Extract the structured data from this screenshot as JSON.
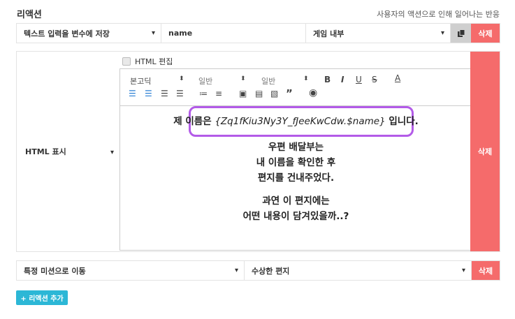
{
  "header": {
    "title": "리액션",
    "subtitle": "사용자의 액션으로 인해 일어나는 반응"
  },
  "row1": {
    "action": "텍스트 입력을 변수에 저장",
    "variable": "name",
    "scope": "게임 내부",
    "delete_label": "삭제"
  },
  "row2": {
    "action": "HTML 표시",
    "html_edit_label": "HTML 편집",
    "toolbar": {
      "font": "본고딕",
      "size": "일반",
      "style": "일반",
      "bold": "B",
      "italic": "I",
      "underline": "U",
      "strike": "S",
      "color": "A"
    },
    "content": {
      "line1_pre": "제 이름은 ",
      "line1_var": "{Zq1fKiu3Ny3Y_fJeeKwCdw.$name}",
      "line1_post": " 입니다.",
      "para1": [
        "우편 배달부는",
        "내 이름을 확인한 후",
        "편지를 건내주었다."
      ],
      "para2": [
        "과연 이 편지에는",
        "어떤 내용이 담겨있을까..?"
      ]
    },
    "delete_label": "삭제"
  },
  "row3": {
    "action": "특정 미션으로 이동",
    "mission": "수상한 편지",
    "delete_label": "삭제"
  },
  "add_button": "+ 리액션 추가",
  "colors": {
    "delete": "#f56b6b",
    "accent": "#2cb7d6",
    "highlight": "#b35be8"
  }
}
